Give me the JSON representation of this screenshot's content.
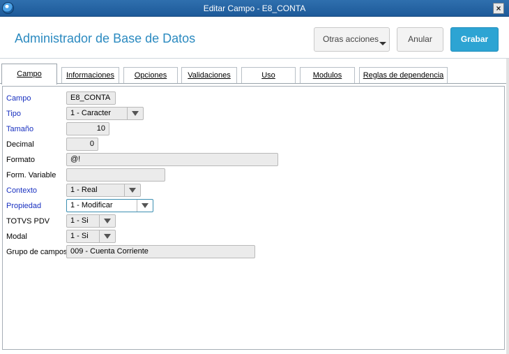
{
  "window": {
    "title": "Editar Campo - E8_CONTA",
    "close_label": "×"
  },
  "header": {
    "app_title": "Administrador de Base de Datos",
    "otras_acciones": "Otras acciones",
    "anular": "Anular",
    "grabar": "Grabar"
  },
  "tabs": [
    {
      "label": "Campo"
    },
    {
      "label": "Informaciones"
    },
    {
      "label": "Opciones"
    },
    {
      "label": "Validaciones"
    },
    {
      "label": "Uso"
    },
    {
      "label": "Modulos"
    },
    {
      "label": "Reglas de dependencia"
    }
  ],
  "form": {
    "campo": {
      "label": "Campo",
      "value": "E8_CONTA"
    },
    "tipo": {
      "label": "Tipo",
      "value": "1 - Caracter"
    },
    "tamano": {
      "label": "Tamaño",
      "value": "10"
    },
    "decimal": {
      "label": "Decimal",
      "value": "0"
    },
    "formato": {
      "label": "Formato",
      "value": "@!"
    },
    "form_variable": {
      "label": "Form. Variable",
      "value": ""
    },
    "contexto": {
      "label": "Contexto",
      "value": "1 - Real"
    },
    "propiedad": {
      "label": "Propiedad",
      "value": "1 - Modificar"
    },
    "totvs_pdv": {
      "label": "TOTVS PDV",
      "value": "1 - Si"
    },
    "modal": {
      "label": "Modal",
      "value": "1 - Si"
    },
    "grupo_campos": {
      "label": "Grupo de campos",
      "value": "009 - Cuenta Corriente"
    }
  },
  "colors": {
    "title_bar": "#1d5a99",
    "accent": "#2da4d3",
    "required_label": "#1830c0"
  }
}
